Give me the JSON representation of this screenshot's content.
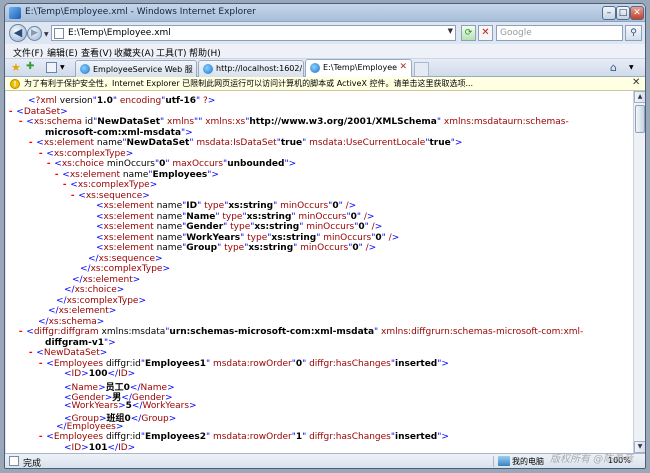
{
  "window": {
    "title": "E:\\Temp\\Employee.xml - Windows Internet Explorer"
  },
  "address": {
    "url": "E:\\Temp\\Employee.xml",
    "search_placeholder": "Google"
  },
  "menu": [
    "文件(F)",
    "编辑(E)",
    "查看(V)",
    "收藏夹(A)",
    "工具(T)",
    "帮助(H)"
  ],
  "tabs": [
    {
      "label": "EmployeeService Web 服务"
    },
    {
      "label": "http://localhost:1602/Emplo..."
    },
    {
      "label": "E:\\Temp\\Employee.xml"
    }
  ],
  "infobar": {
    "text": "为了有利于保护安全性，Internet Explorer 已限制此网页运行可以访问计算机的脚本或 ActiveX 控件。请单击这里获取选项..."
  },
  "xml": [
    {
      "text": "<?xml version=\"1.0\" encoding=\"utf-16\" ?>"
    },
    {
      "text": "- <DataSet>"
    },
    {
      "text": "- <xs:schema id=\"NewDataSet\" xmlns=\"\" xmlns:xs=\"http://www.w3.org/2001/XMLSchema\" xmlns:msdata=\"urn:schemas-"
    },
    {
      "text": "microsoft-com:xml-msdata\">"
    },
    {
      "text": "- <xs:element name=\"NewDataSet\" msdata:IsDataSet=\"true\" msdata:UseCurrentLocale=\"true\">"
    },
    {
      "text": "- <xs:complexType>"
    },
    {
      "text": "- <xs:choice minOccurs=\"0\" maxOccurs=\"unbounded\">"
    },
    {
      "text": "- <xs:element name=\"Employees\">"
    },
    {
      "text": "- <xs:complexType>"
    },
    {
      "text": "- <xs:sequence>"
    },
    {
      "text": "<xs:element name=\"ID\" type=\"xs:string\" minOccurs=\"0\" />"
    },
    {
      "text": "<xs:element name=\"Name\" type=\"xs:string\" minOccurs=\"0\" />"
    },
    {
      "text": "<xs:element name=\"Gender\" type=\"xs:string\" minOccurs=\"0\" />"
    },
    {
      "text": "<xs:element name=\"WorkYears\" type=\"xs:string\" minOccurs=\"0\" />"
    },
    {
      "text": "<xs:element name=\"Group\" type=\"xs:string\" minOccurs=\"0\" />"
    },
    {
      "text": "</xs:sequence>"
    },
    {
      "text": "</xs:complexType>"
    },
    {
      "text": "</xs:element>"
    },
    {
      "text": "</xs:choice>"
    },
    {
      "text": "</xs:complexType>"
    },
    {
      "text": "</xs:element>"
    },
    {
      "text": "</xs:schema>"
    },
    {
      "text": "- <diffgr:diffgram xmlns:msdata=\"urn:schemas-microsoft-com:xml-msdata\" xmlns:diffgr=\"urn:schemas-microsoft-com:xml-"
    },
    {
      "text": "diffgram-v1\">"
    },
    {
      "text": "- <NewDataSet>"
    },
    {
      "text": "- <Employees diffgr:id=\"Employees1\" msdata:rowOrder=\"0\" diffgr:hasChanges=\"inserted\">"
    },
    {
      "text": "<ID>100</ID>"
    },
    {
      "text": "<Name>员工0</Name>"
    },
    {
      "text": "<Gender>男</Gender>"
    },
    {
      "text": "<WorkYears>5</WorkYears>"
    },
    {
      "text": "<Group>班组0</Group>"
    },
    {
      "text": "</Employees>"
    },
    {
      "text": "- <Employees diffgr:id=\"Employees2\" msdata:rowOrder=\"1\" diffgr:hasChanges=\"inserted\">"
    },
    {
      "text": "<ID>101</ID>"
    }
  ],
  "status": {
    "text": "完成",
    "zone": "我的电脑",
    "zoom": "100%",
    "watermark": "版权所有 @陈希章"
  }
}
